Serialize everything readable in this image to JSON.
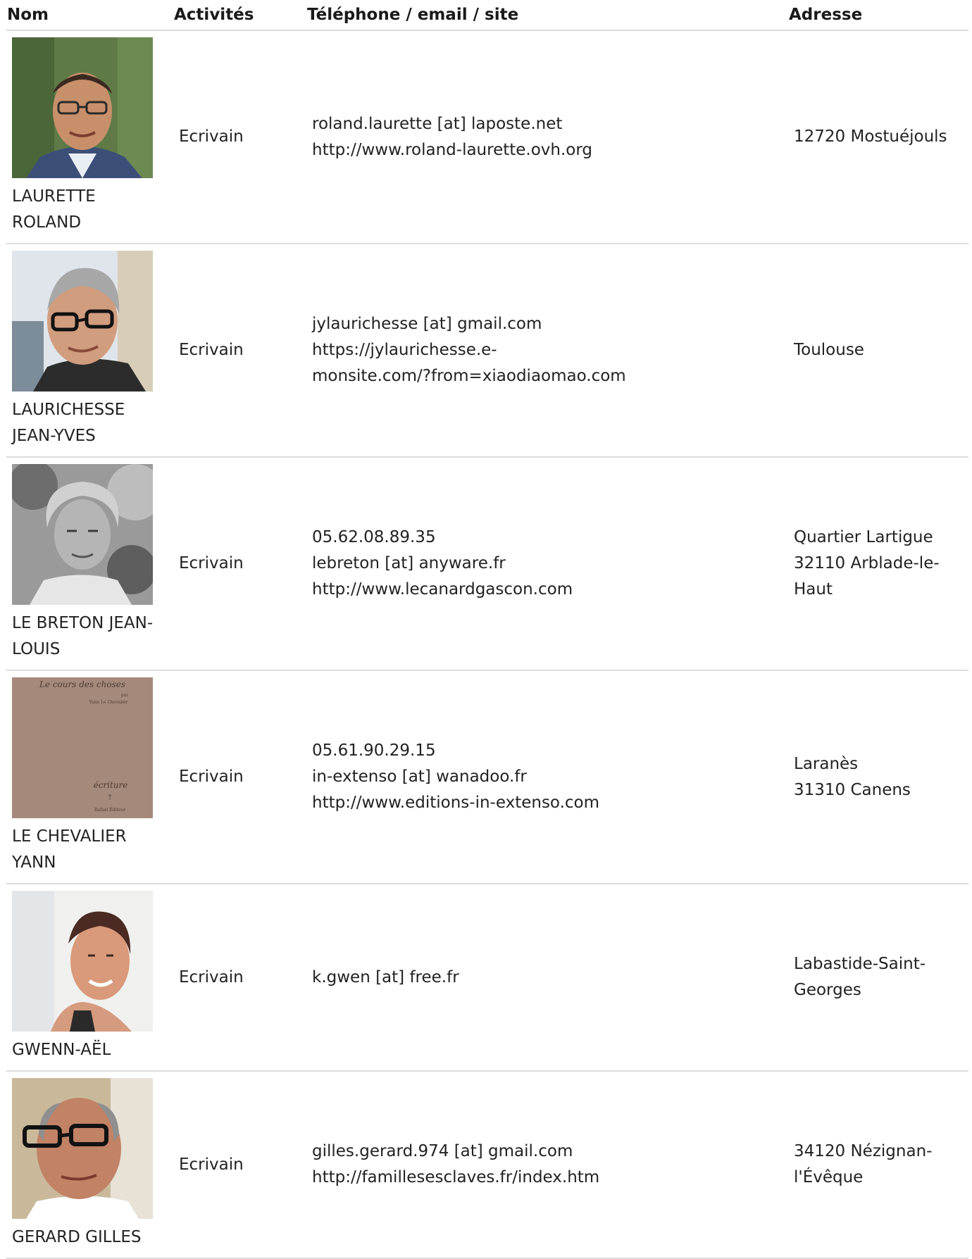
{
  "table": {
    "headers": {
      "name": "Nom",
      "activities": "Activités",
      "contact": "Téléphone / email / site",
      "address": "Adresse"
    },
    "rows": [
      {
        "name_line1": "LAURETTE",
        "name_line2": "ROLAND",
        "activity": "Ecrivain",
        "contact": [
          "roland.laurette [at] laposte.net",
          "http://www.roland-laurette.ovh.org"
        ],
        "address": [
          "12720 Mostuéjouls"
        ]
      },
      {
        "name_line1": "LAURICHESSE",
        "name_line2": "JEAN-YVES",
        "activity": "Ecrivain",
        "contact": [
          "jylaurichesse [at] gmail.com",
          "https://jylaurichesse.e-",
          "monsite.com/?from=xiaodiaomao.com"
        ],
        "address": [
          "Toulouse"
        ]
      },
      {
        "name_line1": "LE BRETON JEAN-",
        "name_line2": "LOUIS",
        "activity": "Ecrivain",
        "contact": [
          "05.62.08.89.35",
          "lebreton [at] anyware.fr",
          "http://www.lecanardgascon.com"
        ],
        "address": [
          "Quartier Lartigue",
          "32110 Arblade-le-",
          "Haut"
        ]
      },
      {
        "name_line1": "LE CHEVALIER",
        "name_line2": "YANN",
        "activity": "Ecrivain",
        "contact": [
          "05.61.90.29.15",
          "in-extenso [at] wanadoo.fr",
          "http://www.editions-in-extenso.com"
        ],
        "address": [
          "Laranès",
          "31310 Canens"
        ],
        "photo_text": {
          "title": "Le cours des choses",
          "by": "par",
          "author": "Yann Le Chevalier",
          "collection": "écriture",
          "publisher": "Rafael Éditeur"
        }
      },
      {
        "name_line1": "GWENN-AËL",
        "name_line2": "",
        "activity": "Ecrivain",
        "contact": [
          "k.gwen [at] free.fr"
        ],
        "address": [
          "Labastide-Saint-",
          "Georges"
        ]
      },
      {
        "name_line1": "GERARD GILLES",
        "name_line2": "",
        "activity": "Ecrivain",
        "contact": [
          "gilles.gerard.974 [at] gmail.com",
          "http://famillesesclaves.fr/index.htm"
        ],
        "address": [
          "34120 Nézignan-",
          "l'Évêque"
        ]
      }
    ]
  }
}
